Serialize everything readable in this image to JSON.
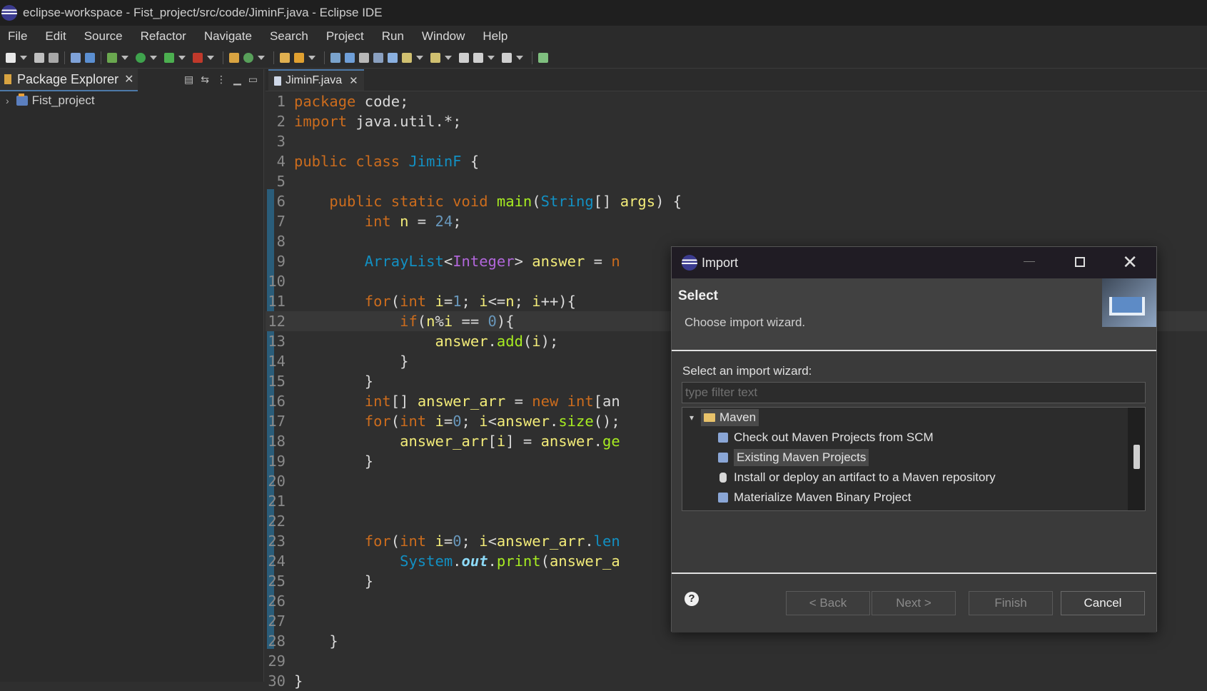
{
  "window": {
    "title": "eclipse-workspace - Fist_project/src/code/JiminF.java - Eclipse IDE"
  },
  "menu": [
    "File",
    "Edit",
    "Source",
    "Refactor",
    "Navigate",
    "Search",
    "Project",
    "Run",
    "Window",
    "Help"
  ],
  "package_explorer": {
    "tab_label": "Package Explorer",
    "close": "✕",
    "project": "Fist_project"
  },
  "editor": {
    "tab_label": "JiminF.java",
    "close": "✕"
  },
  "dialog": {
    "title": "Import",
    "heading": "Select",
    "subheading": "Choose import wizard.",
    "select_label": "Select an import wizard:",
    "filter_placeholder": "type filter text",
    "tree": {
      "category": "Maven",
      "items": [
        "Check out Maven Projects from SCM",
        "Existing Maven Projects",
        "Install or deploy an artifact to a Maven repository",
        "Materialize Maven Binary Project"
      ],
      "selected": "Existing Maven Projects"
    },
    "buttons": {
      "back": "< Back",
      "next": "Next >",
      "finish": "Finish",
      "cancel": "Cancel"
    },
    "help": "?"
  }
}
